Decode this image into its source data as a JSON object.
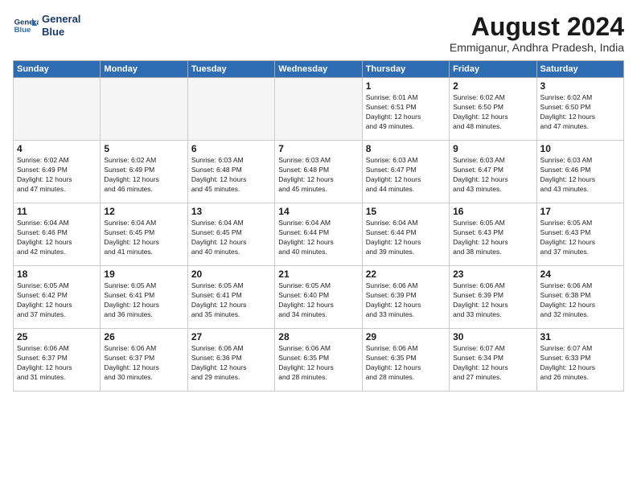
{
  "logo": {
    "line1": "General",
    "line2": "Blue"
  },
  "title": "August 2024",
  "subtitle": "Emmiganur, Andhra Pradesh, India",
  "weekdays": [
    "Sunday",
    "Monday",
    "Tuesday",
    "Wednesday",
    "Thursday",
    "Friday",
    "Saturday"
  ],
  "weeks": [
    [
      {
        "day": "",
        "info": ""
      },
      {
        "day": "",
        "info": ""
      },
      {
        "day": "",
        "info": ""
      },
      {
        "day": "",
        "info": ""
      },
      {
        "day": "1",
        "info": "Sunrise: 6:01 AM\nSunset: 6:51 PM\nDaylight: 12 hours\nand 49 minutes."
      },
      {
        "day": "2",
        "info": "Sunrise: 6:02 AM\nSunset: 6:50 PM\nDaylight: 12 hours\nand 48 minutes."
      },
      {
        "day": "3",
        "info": "Sunrise: 6:02 AM\nSunset: 6:50 PM\nDaylight: 12 hours\nand 47 minutes."
      }
    ],
    [
      {
        "day": "4",
        "info": "Sunrise: 6:02 AM\nSunset: 6:49 PM\nDaylight: 12 hours\nand 47 minutes."
      },
      {
        "day": "5",
        "info": "Sunrise: 6:02 AM\nSunset: 6:49 PM\nDaylight: 12 hours\nand 46 minutes."
      },
      {
        "day": "6",
        "info": "Sunrise: 6:03 AM\nSunset: 6:48 PM\nDaylight: 12 hours\nand 45 minutes."
      },
      {
        "day": "7",
        "info": "Sunrise: 6:03 AM\nSunset: 6:48 PM\nDaylight: 12 hours\nand 45 minutes."
      },
      {
        "day": "8",
        "info": "Sunrise: 6:03 AM\nSunset: 6:47 PM\nDaylight: 12 hours\nand 44 minutes."
      },
      {
        "day": "9",
        "info": "Sunrise: 6:03 AM\nSunset: 6:47 PM\nDaylight: 12 hours\nand 43 minutes."
      },
      {
        "day": "10",
        "info": "Sunrise: 6:03 AM\nSunset: 6:46 PM\nDaylight: 12 hours\nand 43 minutes."
      }
    ],
    [
      {
        "day": "11",
        "info": "Sunrise: 6:04 AM\nSunset: 6:46 PM\nDaylight: 12 hours\nand 42 minutes."
      },
      {
        "day": "12",
        "info": "Sunrise: 6:04 AM\nSunset: 6:45 PM\nDaylight: 12 hours\nand 41 minutes."
      },
      {
        "day": "13",
        "info": "Sunrise: 6:04 AM\nSunset: 6:45 PM\nDaylight: 12 hours\nand 40 minutes."
      },
      {
        "day": "14",
        "info": "Sunrise: 6:04 AM\nSunset: 6:44 PM\nDaylight: 12 hours\nand 40 minutes."
      },
      {
        "day": "15",
        "info": "Sunrise: 6:04 AM\nSunset: 6:44 PM\nDaylight: 12 hours\nand 39 minutes."
      },
      {
        "day": "16",
        "info": "Sunrise: 6:05 AM\nSunset: 6:43 PM\nDaylight: 12 hours\nand 38 minutes."
      },
      {
        "day": "17",
        "info": "Sunrise: 6:05 AM\nSunset: 6:43 PM\nDaylight: 12 hours\nand 37 minutes."
      }
    ],
    [
      {
        "day": "18",
        "info": "Sunrise: 6:05 AM\nSunset: 6:42 PM\nDaylight: 12 hours\nand 37 minutes."
      },
      {
        "day": "19",
        "info": "Sunrise: 6:05 AM\nSunset: 6:41 PM\nDaylight: 12 hours\nand 36 minutes."
      },
      {
        "day": "20",
        "info": "Sunrise: 6:05 AM\nSunset: 6:41 PM\nDaylight: 12 hours\nand 35 minutes."
      },
      {
        "day": "21",
        "info": "Sunrise: 6:05 AM\nSunset: 6:40 PM\nDaylight: 12 hours\nand 34 minutes."
      },
      {
        "day": "22",
        "info": "Sunrise: 6:06 AM\nSunset: 6:39 PM\nDaylight: 12 hours\nand 33 minutes."
      },
      {
        "day": "23",
        "info": "Sunrise: 6:06 AM\nSunset: 6:39 PM\nDaylight: 12 hours\nand 33 minutes."
      },
      {
        "day": "24",
        "info": "Sunrise: 6:06 AM\nSunset: 6:38 PM\nDaylight: 12 hours\nand 32 minutes."
      }
    ],
    [
      {
        "day": "25",
        "info": "Sunrise: 6:06 AM\nSunset: 6:37 PM\nDaylight: 12 hours\nand 31 minutes."
      },
      {
        "day": "26",
        "info": "Sunrise: 6:06 AM\nSunset: 6:37 PM\nDaylight: 12 hours\nand 30 minutes."
      },
      {
        "day": "27",
        "info": "Sunrise: 6:06 AM\nSunset: 6:36 PM\nDaylight: 12 hours\nand 29 minutes."
      },
      {
        "day": "28",
        "info": "Sunrise: 6:06 AM\nSunset: 6:35 PM\nDaylight: 12 hours\nand 28 minutes."
      },
      {
        "day": "29",
        "info": "Sunrise: 6:06 AM\nSunset: 6:35 PM\nDaylight: 12 hours\nand 28 minutes."
      },
      {
        "day": "30",
        "info": "Sunrise: 6:07 AM\nSunset: 6:34 PM\nDaylight: 12 hours\nand 27 minutes."
      },
      {
        "day": "31",
        "info": "Sunrise: 6:07 AM\nSunset: 6:33 PM\nDaylight: 12 hours\nand 26 minutes."
      }
    ]
  ]
}
